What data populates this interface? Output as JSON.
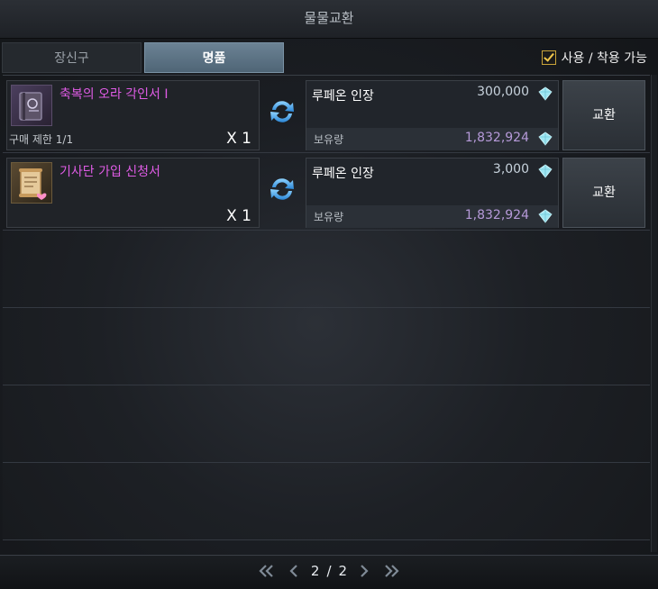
{
  "window": {
    "title": "물물교환"
  },
  "tabs": [
    {
      "label": "장신구",
      "active": false
    },
    {
      "label": "명품",
      "active": true
    }
  ],
  "filter": {
    "label": "사용 / 착용 가능",
    "checked": true
  },
  "trades": [
    {
      "item_name": "축복의 오라 각인서 I",
      "item_icon": "book-icon",
      "limit_text": "구매 제한 1/1",
      "quantity": "X 1",
      "currency_name": "루페온 인장",
      "price": "300,000",
      "owned_label": "보유량",
      "owned": "1,832,924",
      "button_label": "교환"
    },
    {
      "item_name": "기사단 가입 신청서",
      "item_icon": "scroll-icon",
      "limit_text": "",
      "quantity": "X 1",
      "currency_name": "루페온 인장",
      "price": "3,000",
      "owned_label": "보유량",
      "owned": "1,832,924",
      "button_label": "교환"
    }
  ],
  "pager": {
    "current": "2",
    "separator": "/",
    "total": "2"
  },
  "colors": {
    "item_name": "#e05ce6",
    "owned_value": "#b69ad9",
    "active_tab": "#5a7183",
    "checkbox": "#f2c84b"
  }
}
